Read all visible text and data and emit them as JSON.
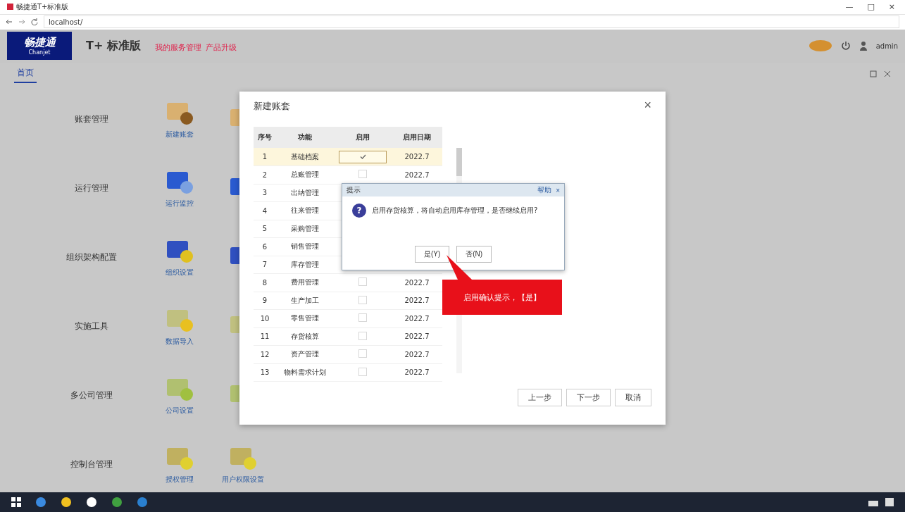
{
  "browser": {
    "tab_title": "畅捷通T+标准版",
    "address": "localhost/",
    "window_controls": [
      "—",
      "□",
      "×"
    ]
  },
  "header": {
    "logo": "畅捷通",
    "logo_sub": "Chanjet",
    "product": "T+ 标准版",
    "links": [
      "我的服务管理",
      "产品升级"
    ],
    "user": "admin"
  },
  "tabs": [
    {
      "label": "首页",
      "selected": true
    }
  ],
  "categories": [
    {
      "label": "账套管理",
      "icons": [
        "新建账套"
      ]
    },
    {
      "label": "运行管理",
      "icons": [
        "运行监控"
      ]
    },
    {
      "label": "组织架构配置",
      "icons": [
        "组织设置"
      ]
    },
    {
      "label": "实施工具",
      "icons": [
        "数据导入"
      ]
    },
    {
      "label": "多公司管理",
      "icons": [
        "公司设置"
      ]
    },
    {
      "label": "控制台管理",
      "icons": [
        "授权管理",
        "用户权限设置"
      ]
    }
  ],
  "dialog": {
    "title": "新建账套",
    "close": "×",
    "table": {
      "columns": [
        "序号",
        "功能",
        "启用",
        "启用日期"
      ],
      "rows": [
        {
          "no": "1",
          "name": "基础档案",
          "checked": true,
          "date": "2022.7",
          "selected": true
        },
        {
          "no": "2",
          "name": "总账管理",
          "checked": false,
          "date": "2022.7",
          "selected": false
        },
        {
          "no": "3",
          "name": "出纳管理",
          "selected": false
        },
        {
          "no": "4",
          "name": "往来管理",
          "selected": false
        },
        {
          "no": "5",
          "name": "采购管理",
          "selected": false
        },
        {
          "no": "6",
          "name": "销售管理",
          "selected": false
        },
        {
          "no": "7",
          "name": "库存管理",
          "selected": false
        },
        {
          "no": "8",
          "name": "费用管理",
          "checked": false,
          "date": "2022.7",
          "selected": false
        },
        {
          "no": "9",
          "name": "生产加工",
          "checked": false,
          "date": "2022.7",
          "selected": false
        },
        {
          "no": "10",
          "name": "零售管理",
          "checked": false,
          "date": "2022.7",
          "selected": false
        },
        {
          "no": "11",
          "name": "存货核算",
          "checked": false,
          "date": "2022.7",
          "selected": false
        },
        {
          "no": "12",
          "name": "资产管理",
          "checked": false,
          "date": "2022.7",
          "selected": false
        },
        {
          "no": "13",
          "name": "物料需求计划",
          "checked": false,
          "date": "2022.7",
          "selected": false
        }
      ]
    },
    "buttons": [
      "上一步",
      "下一步",
      "取消"
    ]
  },
  "prompt": {
    "icon": "?",
    "title": "提示",
    "help": "帮助",
    "close": "×",
    "message": "启用存货核算，将自动启用库存管理，是否继续启用?",
    "buttons": [
      "是(Y)",
      "否(N)"
    ]
  },
  "callout": "启用确认提示，【是】"
}
